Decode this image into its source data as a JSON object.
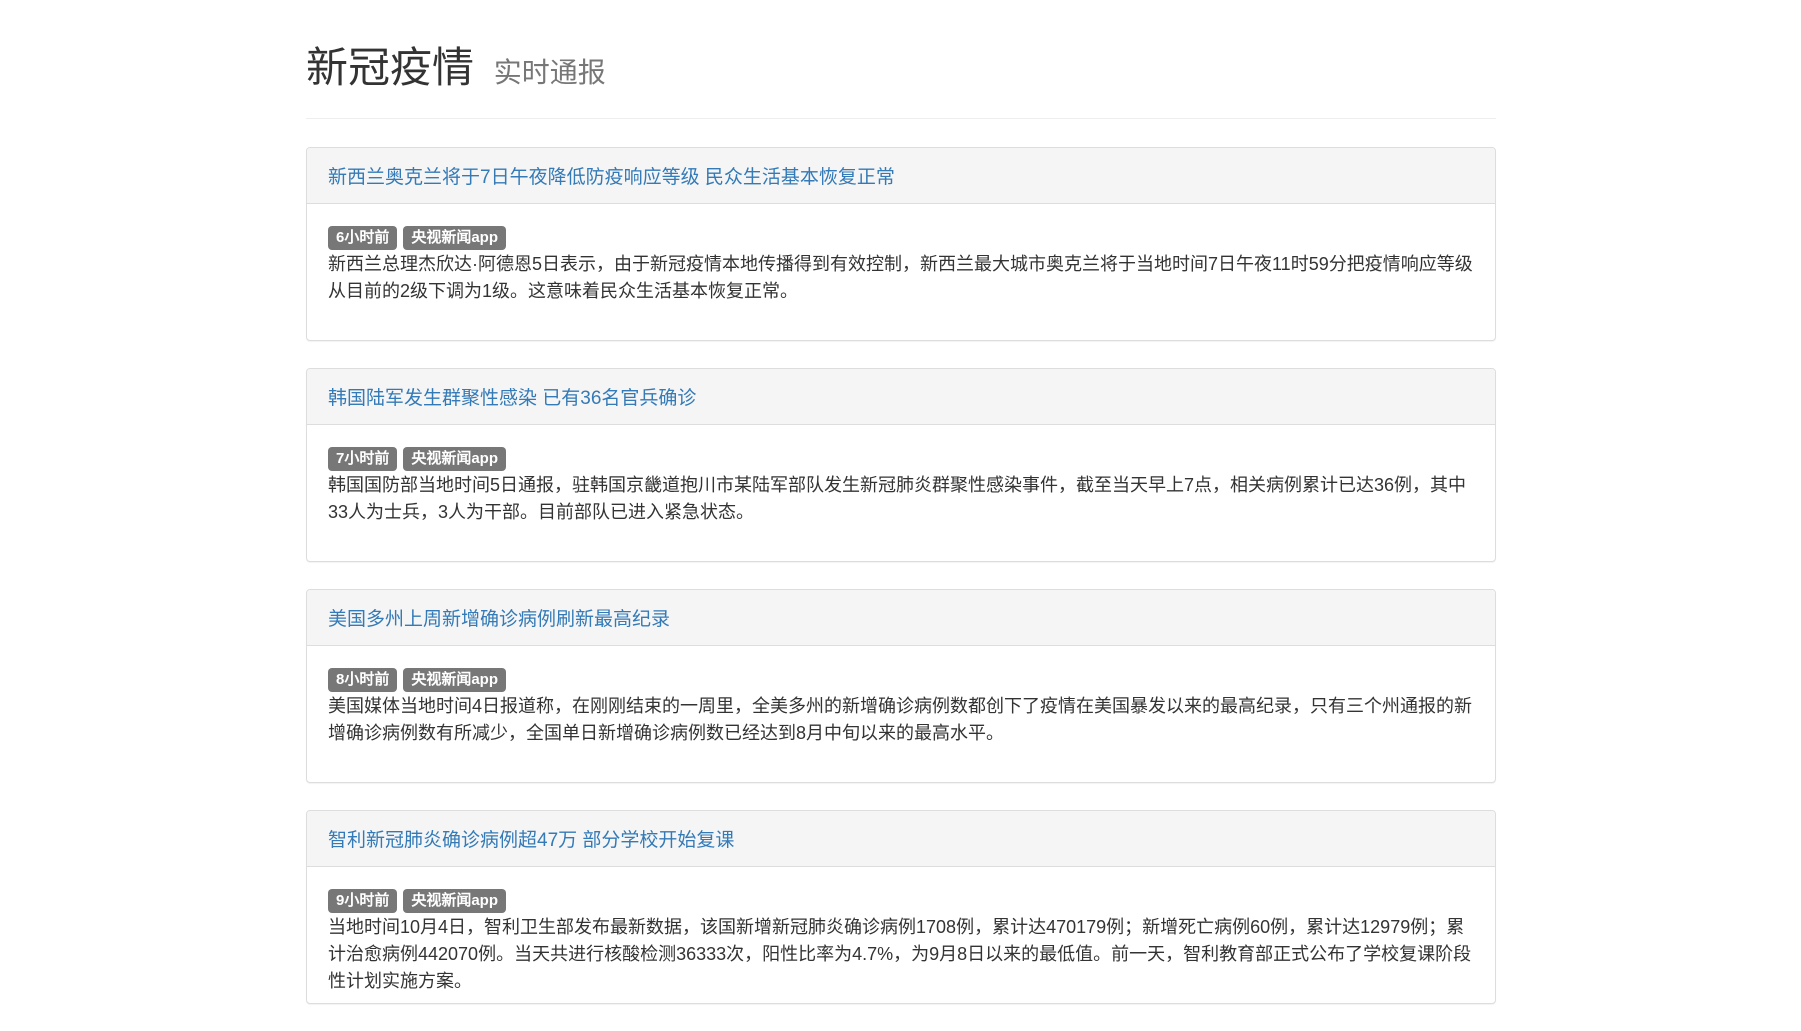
{
  "header": {
    "title": "新冠疫情",
    "subtitle": "实时通报"
  },
  "news": [
    {
      "title": "新西兰奥克兰将于7日午夜降低防疫响应等级 民众生活基本恢复正常",
      "time": "6小时前",
      "source": "央视新闻app",
      "summary": "新西兰总理杰欣达·阿德恩5日表示，由于新冠疫情本地传播得到有效控制，新西兰最大城市奥克兰将于当地时间7日午夜11时59分把疫情响应等级从目前的2级下调为1级。这意味着民众生活基本恢复正常。"
    },
    {
      "title": "韩国陆军发生群聚性感染 已有36名官兵确诊",
      "time": "7小时前",
      "source": "央视新闻app",
      "summary": "韩国国防部当地时间5日通报，驻韩国京畿道抱川市某陆军部队发生新冠肺炎群聚性感染事件，截至当天早上7点，相关病例累计已达36例，其中33人为士兵，3人为干部。目前部队已进入紧急状态。"
    },
    {
      "title": "美国多州上周新增确诊病例刷新最高纪录",
      "time": "8小时前",
      "source": "央视新闻app",
      "summary": "美国媒体当地时间4日报道称，在刚刚结束的一周里，全美多州的新增确诊病例数都创下了疫情在美国暴发以来的最高纪录，只有三个州通报的新增确诊病例数有所减少，全国单日新增确诊病例数已经达到8月中旬以来的最高水平。"
    },
    {
      "title": "智利新冠肺炎确诊病例超47万 部分学校开始复课",
      "time": "9小时前",
      "source": "央视新闻app",
      "summary": "当地时间10月4日，智利卫生部发布最新数据，该国新增新冠肺炎确诊病例1708例，累计达470179例；新增死亡病例60例，累计达12979例；累计治愈病例442070例。当天共进行核酸检测36333次，阳性比率为4.7%，为9月8日以来的最低值。前一天，智利教育部正式公布了学校复课阶段性计划实施方案。"
    }
  ]
}
